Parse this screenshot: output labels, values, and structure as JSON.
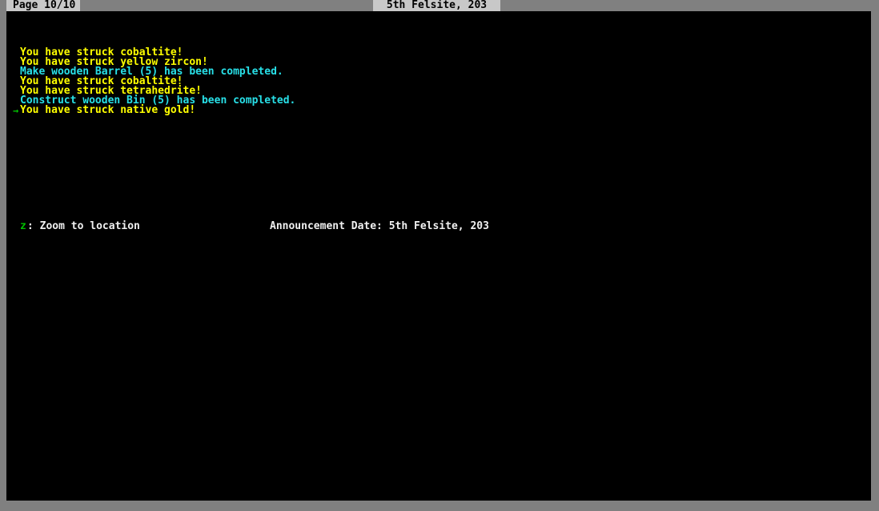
{
  "window": {
    "frame_color": "#808080",
    "screen_background": "#000000"
  },
  "header": {
    "page_indicator": "Page 10/10",
    "date": "5th Felsite, 203",
    "label_bg_color": "#c8c8c8",
    "label_text_color": "#000000"
  },
  "messages": {
    "marker_glyph": "→",
    "marker_color": "#00c000",
    "colors": {
      "strike": "#ffff00",
      "job_completed": "#28e0e8"
    },
    "lines": [
      {
        "text": "You have struck cobaltite!",
        "color": "yellow",
        "marker": false
      },
      {
        "text": "You have struck yellow zircon!",
        "color": "yellow",
        "marker": false
      },
      {
        "text": "Make wooden Barrel (5) has been completed.",
        "color": "cyan",
        "marker": false
      },
      {
        "text": "You have struck cobaltite!",
        "color": "yellow",
        "marker": false
      },
      {
        "text": "You have struck tetrahedrite!",
        "color": "yellow",
        "marker": false
      },
      {
        "text": "Construct wooden Bin (5) has been completed.",
        "color": "cyan",
        "marker": false
      },
      {
        "text": "You have struck native gold!",
        "color": "yellow",
        "marker": true
      }
    ]
  },
  "footer": {
    "zoom_hotkey": "z",
    "zoom_hotkey_label": ": Zoom to location",
    "announcement_date": "Announcement Date: 5th Felsite, 203",
    "hotkey_color": "#00c000",
    "text_color": "#f0f0f0"
  }
}
